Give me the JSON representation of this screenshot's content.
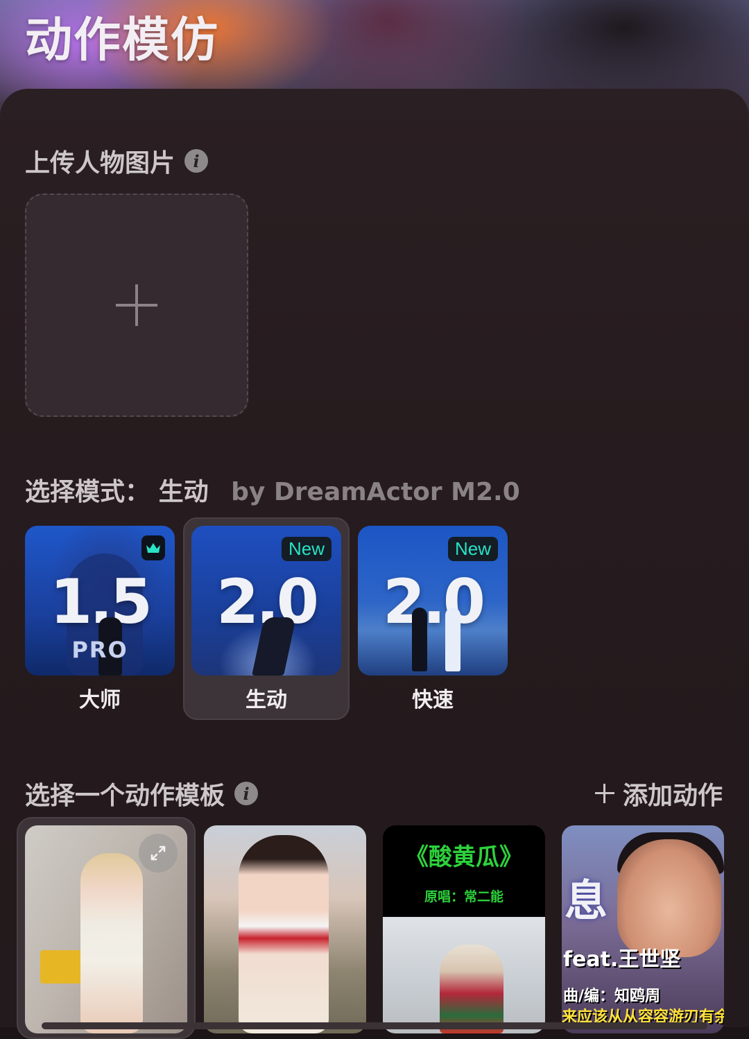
{
  "app": {
    "title": "动作模仿"
  },
  "upload": {
    "title": "上传人物图片",
    "info_icon": "info-icon",
    "add_icon": "plus-icon"
  },
  "mode": {
    "label": "选择模式：",
    "current": "生动",
    "by": "by DreamActor M2.0",
    "cards": [
      {
        "big": "1.5",
        "sub": "PRO",
        "badge": "crown",
        "label": "大师",
        "selected": false
      },
      {
        "big": "2.0",
        "badge": "New",
        "label": "生动",
        "selected": true
      },
      {
        "big": "2.0",
        "badge": "New",
        "label": "快速",
        "selected": false
      }
    ]
  },
  "templates": {
    "title": "选择一个动作模板",
    "add_label": "添加动作",
    "items": [
      {
        "type": "video",
        "selected": true
      },
      {
        "type": "video",
        "selected": false
      },
      {
        "type": "video",
        "title": "《酸黄瓜》",
        "subtitle": "原唱：常二能",
        "selected": false
      },
      {
        "type": "video",
        "big": "息",
        "feat": "feat.王世坚",
        "credit": "曲/编：知鸥周",
        "line": "来应该从从容容游刃有余",
        "selected": false
      }
    ]
  },
  "colors": {
    "accent_new": "#28e3c5",
    "lyric_green": "#2dd13b",
    "lyric_yellow": "#ffe23a"
  }
}
